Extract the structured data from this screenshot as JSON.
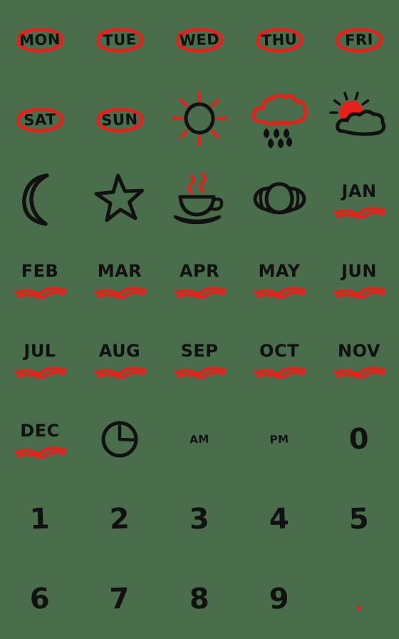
{
  "sheet": {
    "background_color": "#4a6e4c",
    "ink_black": "#111111",
    "ink_red": "#e8201a",
    "columns": 5,
    "rows": 8,
    "style": "hand-drawn emoji sticker sheet"
  },
  "items": [
    {
      "id": "mon",
      "kind": "text-oval",
      "label": "MON",
      "text_color": "#111111",
      "accent_color": "#e8201a"
    },
    {
      "id": "tue",
      "kind": "text-oval",
      "label": "TUE",
      "text_color": "#111111",
      "accent_color": "#e8201a"
    },
    {
      "id": "wed",
      "kind": "text-oval",
      "label": "WED",
      "text_color": "#111111",
      "accent_color": "#e8201a"
    },
    {
      "id": "thu",
      "kind": "text-oval",
      "label": "THU",
      "text_color": "#111111",
      "accent_color": "#e8201a"
    },
    {
      "id": "fri",
      "kind": "text-oval",
      "label": "FRI",
      "text_color": "#111111",
      "accent_color": "#e8201a"
    },
    {
      "id": "sat",
      "kind": "text-oval",
      "label": "SAT",
      "text_color": "#111111",
      "accent_color": "#e8201a"
    },
    {
      "id": "sun",
      "kind": "text-oval",
      "label": "SUN",
      "text_color": "#111111",
      "accent_color": "#e8201a"
    },
    {
      "id": "sun-icon",
      "kind": "icon",
      "label": "",
      "icon": "sun-icon",
      "text_color": "#111111",
      "accent_color": "#e8201a"
    },
    {
      "id": "rain-icon",
      "kind": "icon",
      "label": "",
      "icon": "rain-cloud-icon",
      "text_color": "#111111",
      "accent_color": "#e8201a"
    },
    {
      "id": "partly-icon",
      "kind": "icon",
      "label": "",
      "icon": "sun-behind-cloud-icon",
      "text_color": "#111111",
      "accent_color": "#e8201a"
    },
    {
      "id": "moon-icon",
      "kind": "icon",
      "label": "",
      "icon": "crescent-moon-icon",
      "text_color": "#111111",
      "accent_color": "#e8201a"
    },
    {
      "id": "star-icon",
      "kind": "icon",
      "label": "",
      "icon": "star-icon",
      "text_color": "#111111",
      "accent_color": "#e8201a"
    },
    {
      "id": "coffee-icon",
      "kind": "icon",
      "label": "",
      "icon": "coffee-cup-icon",
      "text_color": "#111111",
      "accent_color": "#e8201a"
    },
    {
      "id": "croissant-icon",
      "kind": "icon",
      "label": "",
      "icon": "croissant-icon",
      "text_color": "#111111",
      "accent_color": "#e8201a"
    },
    {
      "id": "jan",
      "kind": "text-underline",
      "label": "JAN",
      "text_color": "#111111",
      "accent_color": "#e8201a"
    },
    {
      "id": "feb",
      "kind": "text-underline",
      "label": "FEB",
      "text_color": "#111111",
      "accent_color": "#e8201a"
    },
    {
      "id": "mar",
      "kind": "text-underline",
      "label": "MAR",
      "text_color": "#111111",
      "accent_color": "#e8201a"
    },
    {
      "id": "apr",
      "kind": "text-underline",
      "label": "APR",
      "text_color": "#111111",
      "accent_color": "#e8201a"
    },
    {
      "id": "may",
      "kind": "text-underline",
      "label": "MAY",
      "text_color": "#111111",
      "accent_color": "#e8201a"
    },
    {
      "id": "jun",
      "kind": "text-underline",
      "label": "JUN",
      "text_color": "#111111",
      "accent_color": "#e8201a"
    },
    {
      "id": "jul",
      "kind": "text-underline",
      "label": "JUL",
      "text_color": "#111111",
      "accent_color": "#e8201a"
    },
    {
      "id": "aug",
      "kind": "text-underline",
      "label": "AUG",
      "text_color": "#111111",
      "accent_color": "#e8201a"
    },
    {
      "id": "sep",
      "kind": "text-underline",
      "label": "SEP",
      "text_color": "#111111",
      "accent_color": "#e8201a"
    },
    {
      "id": "oct",
      "kind": "text-underline",
      "label": "OCT",
      "text_color": "#111111",
      "accent_color": "#e8201a"
    },
    {
      "id": "nov",
      "kind": "text-underline",
      "label": "NOV",
      "text_color": "#111111",
      "accent_color": "#e8201a"
    },
    {
      "id": "dec",
      "kind": "text-underline",
      "label": "DEC",
      "text_color": "#111111",
      "accent_color": "#e8201a"
    },
    {
      "id": "clock-icon",
      "kind": "icon",
      "label": "",
      "icon": "clock-icon",
      "text_color": "#111111",
      "accent_color": "#e8201a"
    },
    {
      "id": "am",
      "kind": "text-small",
      "label": "AM",
      "text_color": "#111111",
      "accent_color": "#e8201a"
    },
    {
      "id": "pm",
      "kind": "text-small",
      "label": "PM",
      "text_color": "#111111",
      "accent_color": "#e8201a"
    },
    {
      "id": "zero",
      "kind": "digit",
      "label": "0",
      "text_color": "#111111",
      "accent_color": "#e8201a"
    },
    {
      "id": "one",
      "kind": "digit",
      "label": "1",
      "text_color": "#111111",
      "accent_color": "#e8201a"
    },
    {
      "id": "two",
      "kind": "digit",
      "label": "2",
      "text_color": "#111111",
      "accent_color": "#e8201a"
    },
    {
      "id": "three",
      "kind": "digit",
      "label": "3",
      "text_color": "#111111",
      "accent_color": "#e8201a"
    },
    {
      "id": "four",
      "kind": "digit",
      "label": "4",
      "text_color": "#111111",
      "accent_color": "#e8201a"
    },
    {
      "id": "five",
      "kind": "digit",
      "label": "5",
      "text_color": "#111111",
      "accent_color": "#e8201a"
    },
    {
      "id": "six",
      "kind": "digit",
      "label": "6",
      "text_color": "#111111",
      "accent_color": "#e8201a"
    },
    {
      "id": "seven",
      "kind": "digit",
      "label": "7",
      "text_color": "#111111",
      "accent_color": "#e8201a"
    },
    {
      "id": "eight",
      "kind": "digit",
      "label": "8",
      "text_color": "#111111",
      "accent_color": "#e8201a"
    },
    {
      "id": "nine",
      "kind": "digit",
      "label": "9",
      "text_color": "#111111",
      "accent_color": "#e8201a"
    },
    {
      "id": "dot",
      "kind": "dot",
      "label": ".",
      "text_color": "#e8201a",
      "accent_color": "#e8201a"
    }
  ]
}
